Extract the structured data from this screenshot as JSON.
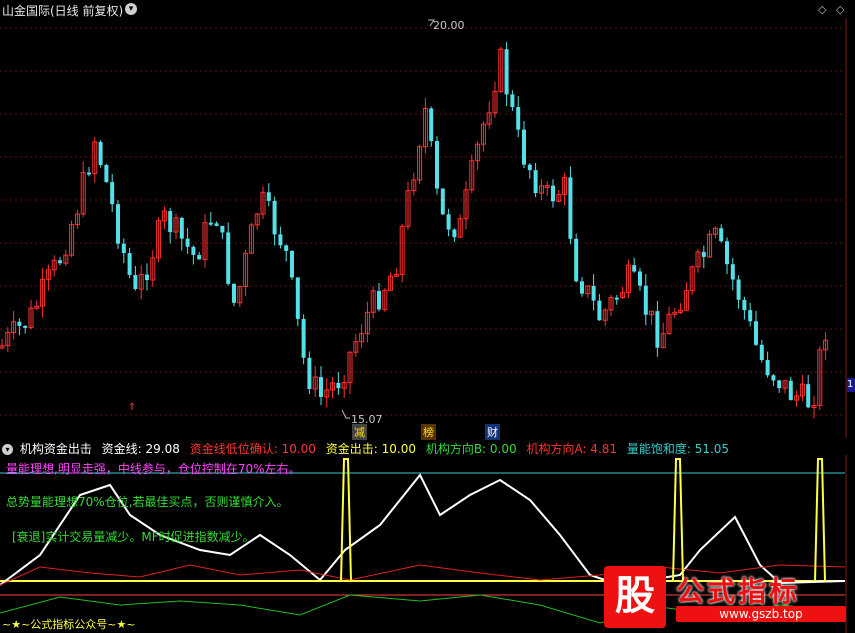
{
  "window": {
    "title": "山金国际(日线 前复权)"
  },
  "main": {
    "high_label": "20.00",
    "low_label": "15.07",
    "tags": [
      {
        "text": "减",
        "color": "#ffdd00",
        "bg": "#444",
        "name": "tag-jian"
      },
      {
        "text": "榜",
        "color": "#ffdd00",
        "bg": "#553300",
        "name": "tag-bang"
      },
      {
        "text": "财",
        "color": "#ffffff",
        "bg": "#113377",
        "name": "tag-cai"
      }
    ],
    "right_badge": "1"
  },
  "indicator": {
    "name": "机构资金出击",
    "items": [
      {
        "label": "资金线: 29.08",
        "color": "#ffffff"
      },
      {
        "label": "资金线低位确认: 10.00",
        "color": "#ff3333"
      },
      {
        "label": "资金出击: 10.00",
        "color": "#ffff40"
      },
      {
        "label": "机构方向B: 0.00",
        "color": "#33dd33"
      },
      {
        "label": "机构方向A: 4.81",
        "color": "#ff3333"
      },
      {
        "label": "量能饱和度: 51.05",
        "color": "#33cccc"
      }
    ],
    "notes": [
      {
        "text": "量能理想,明显走强，中线参与，仓位控制在70%左右。",
        "color": "#ff44ff"
      },
      {
        "text": "总势量能理想70%仓位,若最佳买点，否则谨慎介入。",
        "color": "#33dd33"
      },
      {
        "text": "[衰退]实计交易量减少。MF时促进指数减少。",
        "color": "#33dd33"
      }
    ],
    "bottom_text": "~★~公式指标公众号~★~"
  },
  "logo": {
    "char": "股",
    "text": "公式指标",
    "url": "www.gszb.top"
  }
}
